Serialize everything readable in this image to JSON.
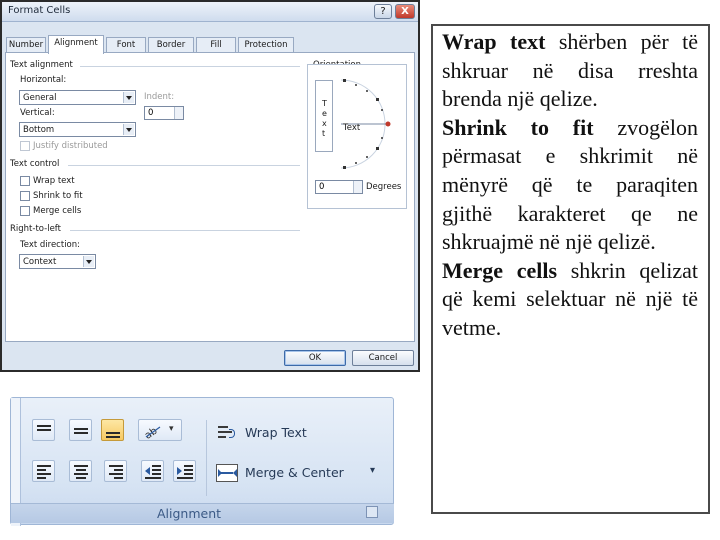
{
  "dialog": {
    "title": "Format Cells",
    "help_label": "?",
    "close_label": "X",
    "tabs": [
      {
        "label": "Number",
        "active": false
      },
      {
        "label": "Alignment",
        "active": true
      },
      {
        "label": "Font",
        "active": false
      },
      {
        "label": "Border",
        "active": false
      },
      {
        "label": "Fill",
        "active": false
      },
      {
        "label": "Protection",
        "active": false
      }
    ],
    "text_alignment": {
      "heading": "Text alignment",
      "horizontal_label": "Horizontal:",
      "horizontal_value": "General",
      "indent_label": "Indent:",
      "indent_value": "0",
      "vertical_label": "Vertical:",
      "vertical_value": "Bottom",
      "justify_distributed_label": "Justify distributed"
    },
    "text_control": {
      "heading": "Text control",
      "wrap_text_label": "Wrap text",
      "shrink_to_fit_label": "Shrink to fit",
      "merge_cells_label": "Merge cells"
    },
    "right_to_left": {
      "heading": "Right-to-left",
      "direction_label": "Text direction:",
      "direction_value": "Context"
    },
    "orientation": {
      "heading": "Orientation",
      "vertical_text": [
        "T",
        "e",
        "x",
        "t"
      ],
      "dial_text": "Text",
      "degrees_value": "0",
      "degrees_label": "Degrees"
    },
    "ok_label": "OK",
    "cancel_label": "Cancel"
  },
  "ribbon": {
    "wrap_text_label": "Wrap Text",
    "merge_center_label": "Merge & Center",
    "merge_dropdown_glyph": "▾",
    "orientation_dropdown_glyph": "▾",
    "group_label": "Alignment",
    "accent_color": "#f7c962"
  },
  "description": {
    "wrap_term": "Wrap text",
    "wrap_text": " shërben për të shkruar në disa rreshta brenda një qelize.",
    "shrink_term": "Shrink to fit",
    "shrink_text": " zvogëlon përmasat e shkrimit në mënyrë që te paraqiten gjithë karakteret qe ne shkruajmë në një qelizë.",
    "merge_term": "Merge cells",
    "merge_text": " shkrin qelizat që kemi selektuar në një të vetme."
  }
}
